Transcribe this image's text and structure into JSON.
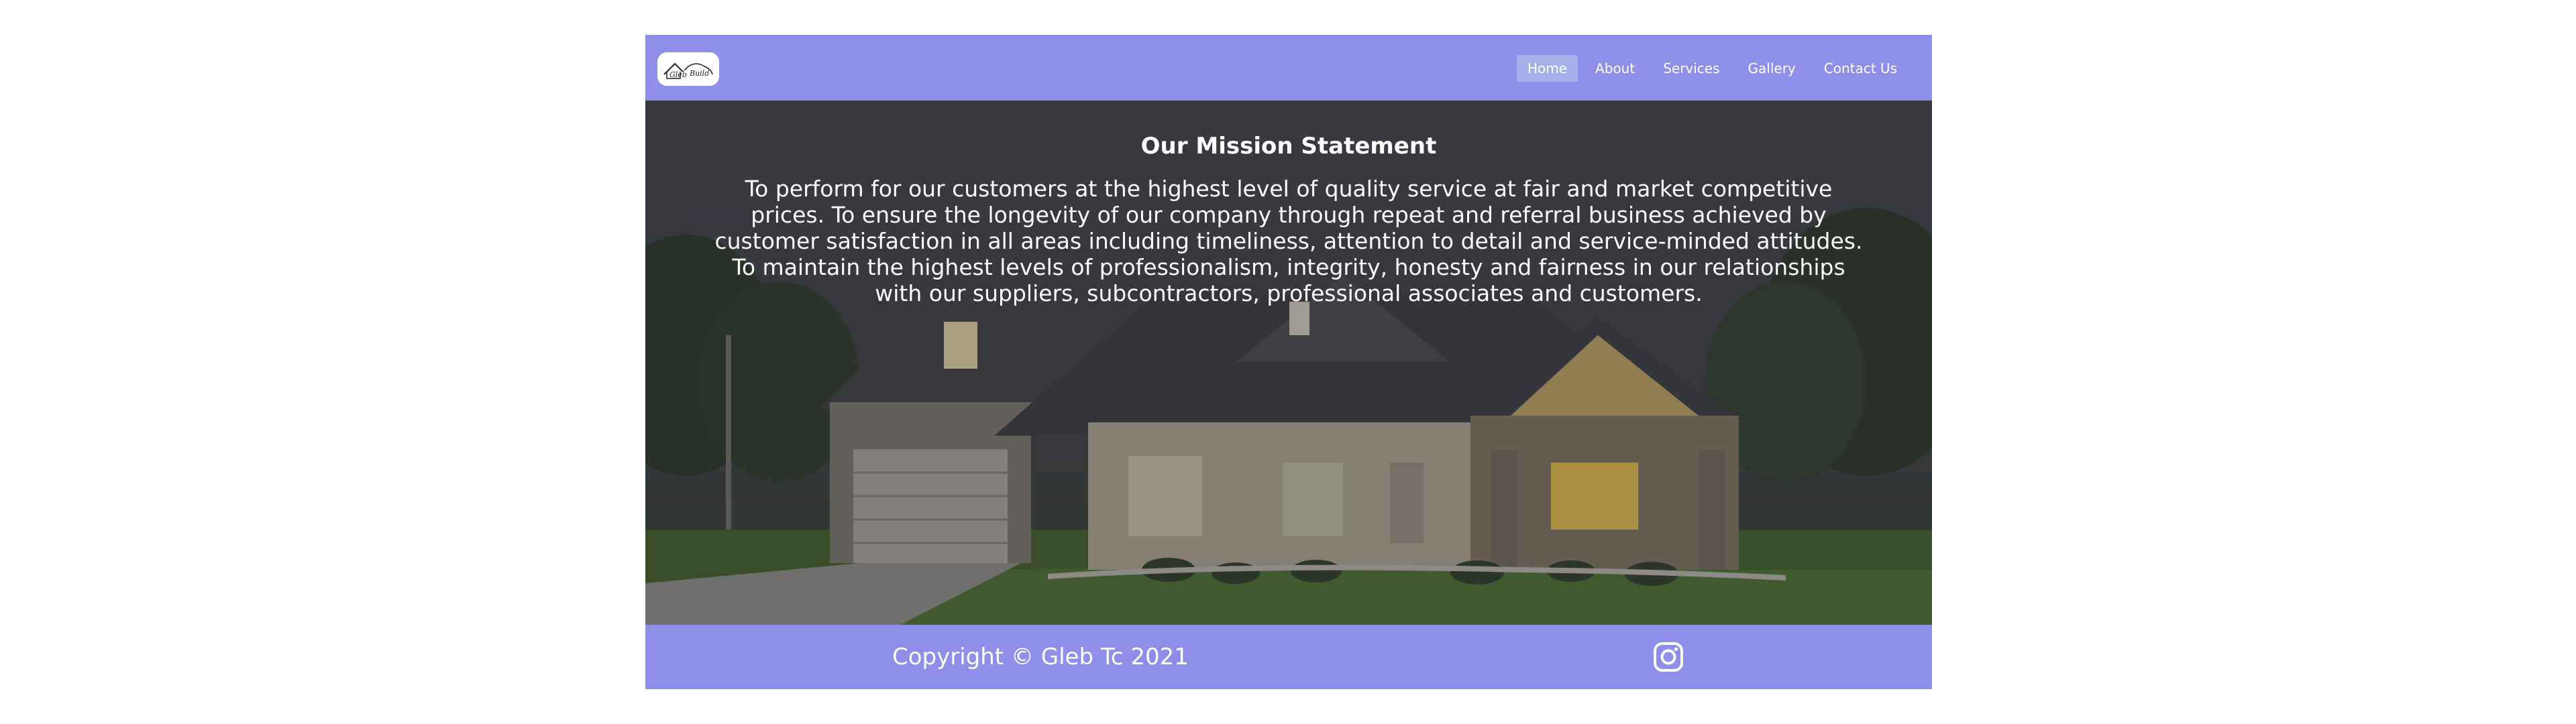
{
  "brand": {
    "logo_icon": "house-logo-icon",
    "logo_text": "Gleb Build"
  },
  "nav": {
    "items": [
      {
        "label": "Home",
        "active": true
      },
      {
        "label": "About",
        "active": false
      },
      {
        "label": "Services",
        "active": false
      },
      {
        "label": "Gallery",
        "active": false
      },
      {
        "label": "Contact Us",
        "active": false
      }
    ]
  },
  "hero": {
    "title": "Our Mission Statement",
    "text": "To perform for our customers at the highest level of quality service at fair and market competitive prices. To ensure the longevity of our company through repeat and referral business achieved by customer satisfaction in all areas including timeliness, attention to detail and service-minded attitudes. To maintain the highest levels of professionalism, integrity, honesty and fairness in our relationships with our suppliers, subcontractors, professional associates and customers."
  },
  "footer": {
    "copyright": "Copyright © Gleb Tc 2021",
    "social_icon": "instagram-icon"
  },
  "colors": {
    "header_bg": "#8f8fea",
    "footer_bg": "#8f8fea",
    "nav_active_bg": "#a6b1ec",
    "text": "#ffffff"
  }
}
